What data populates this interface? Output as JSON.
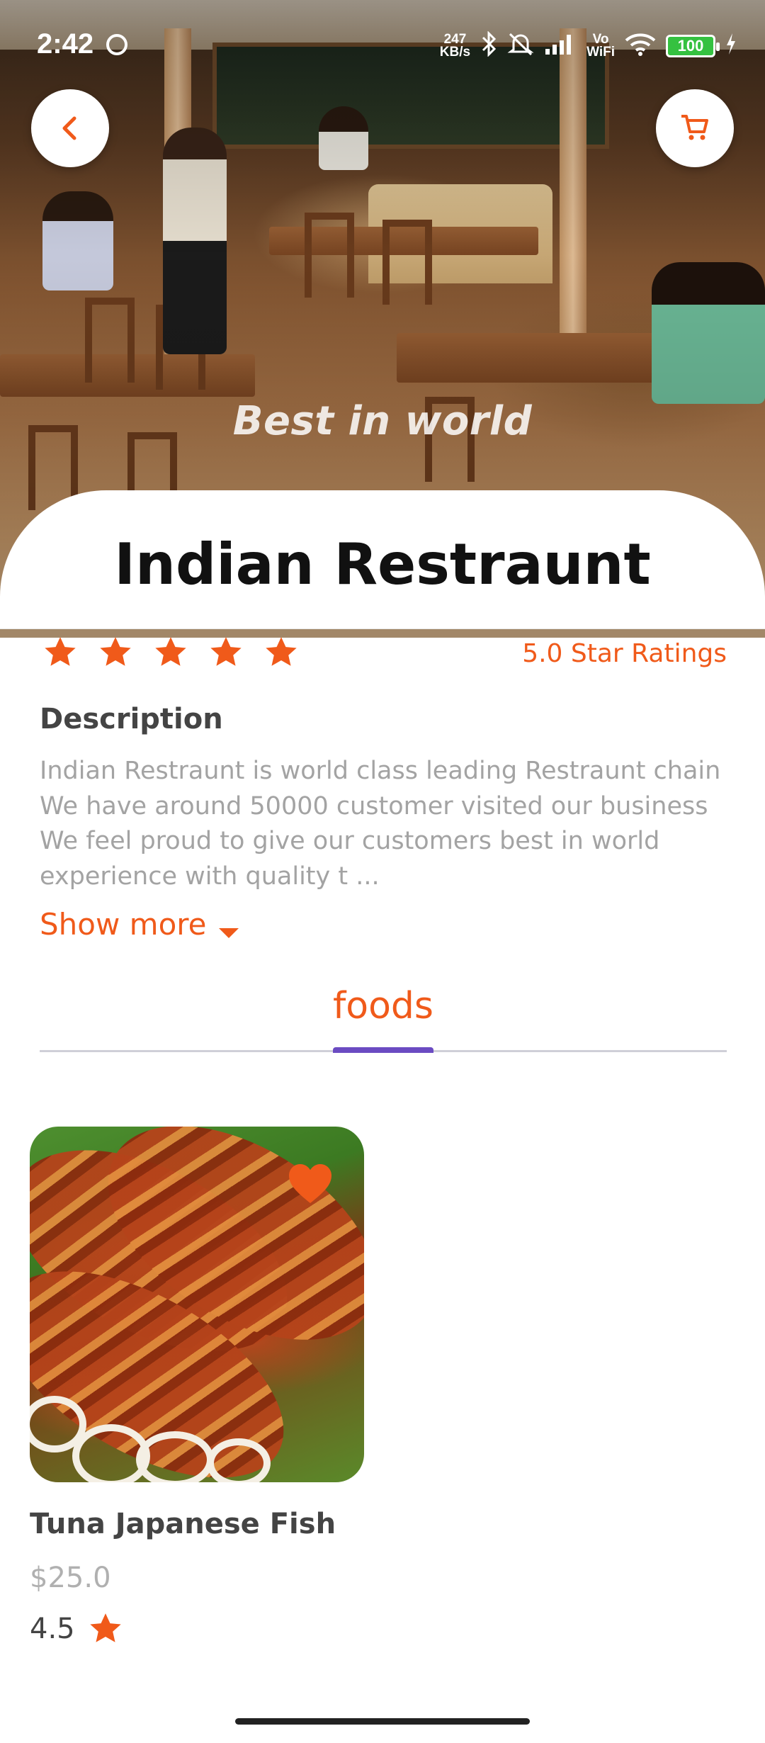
{
  "status_bar": {
    "time": "2:42",
    "net_speed_value": "247",
    "net_speed_unit": "KB/s",
    "network_label_top": "Vo",
    "network_label_bottom": "WiFi",
    "battery": "100"
  },
  "hero": {
    "tagline": "Best in world",
    "back_icon": "chevron-left-icon",
    "cart_icon": "shopping-cart-icon"
  },
  "restaurant": {
    "name": "Indian Restraunt",
    "rating_stars": 5,
    "rating_text": "5.0 Star Ratings"
  },
  "description": {
    "heading": "Description",
    "lines": [
      "Indian Restraunt is world class leading Restraunt chain",
      "We have around 50000 customer visited our business",
      "We feel proud to give our customers best in world",
      "experience with quality t ..."
    ],
    "show_more": "Show more"
  },
  "tabs": {
    "active": "foods"
  },
  "foods": [
    {
      "name": "Tuna Japanese Fish",
      "price": "$25.0",
      "rating": "4.5",
      "favorite": true
    }
  ],
  "colors": {
    "accent": "#f05a1a",
    "tab_indicator": "#6b4bc2",
    "muted_text": "#a3a3a3"
  }
}
